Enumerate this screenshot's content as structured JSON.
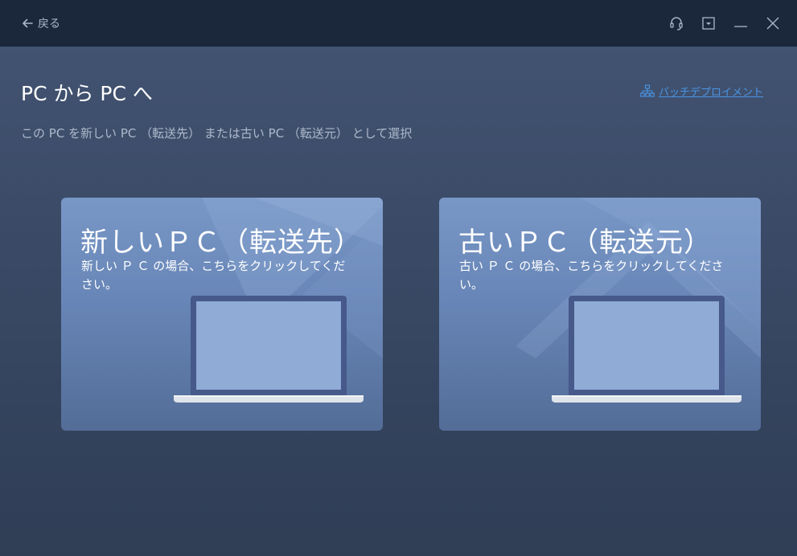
{
  "header": {
    "back_label": "戻る"
  },
  "page": {
    "title": "PC から PC へ",
    "subtitle": "この PC を新しい PC （転送先） または古い PC （転送元） として選択",
    "batch_link": "バッチデプロイメント"
  },
  "cards": [
    {
      "title": "新しいＰＣ（転送先）",
      "description": "新しい Ｐ Ｃ の場合、こちらをクリックしてください。"
    },
    {
      "title": "古いＰＣ（転送元）",
      "description": "古い Ｐ Ｃ の場合、こちらをクリックしてください。"
    }
  ],
  "colors": {
    "titlebar": "#1b273b",
    "background": "#3b4b67",
    "card": "#6785b6",
    "link": "#4a95e6"
  },
  "icons": [
    "arrow-left-icon",
    "headset-icon",
    "dropdown-icon",
    "minimize-icon",
    "close-icon",
    "network-icon",
    "laptop-icon"
  ]
}
